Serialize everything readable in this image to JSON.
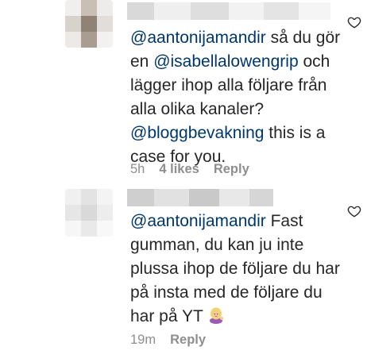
{
  "comments": [
    {
      "mention1": "@aantonijamandir",
      "text1": " så du gör en ",
      "mention2": "@isabellalowengrip",
      "text2": " och lägger ihop alla följare från alla olika kanaler? ",
      "mention3": "@bloggbevakning",
      "text3": " this is a case for you.",
      "time": "5h",
      "likes": "4 likes",
      "reply": "Reply"
    },
    {
      "mention1": "@aantonijamandir",
      "text1": " Fast gumman, du kan ju inte plussa ihop de följare du har på insta med de följare du har på YT ",
      "time": "19m",
      "reply": "Reply"
    }
  ],
  "colors": {
    "mention": "#00376b",
    "text": "#262626",
    "meta": "#8e8e8e",
    "heart_stroke": "#262626"
  },
  "icons": {
    "like": "heart-outline-icon",
    "emoji": "woman-tipping-hand-emoji"
  }
}
